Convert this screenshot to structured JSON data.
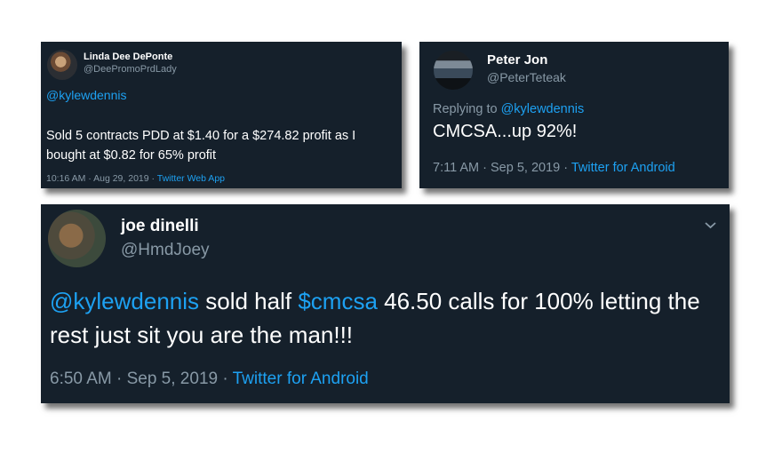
{
  "tweets": [
    {
      "name": "Linda Dee DePonte",
      "handle": "@DeePromoPrdLady",
      "mention": "@kylewdennis",
      "text": "Sold 5 contracts PDD at $1.40 for a $274.82 profit as I bought at $0.82 for 65% profit",
      "time": "10:16 AM · Aug 29, 2019 · ",
      "source": "Twitter Web App"
    },
    {
      "name": "Peter Jon",
      "handle": "@PeterTeteak",
      "replying_prefix": "Replying to ",
      "replying_to": "@kylewdennis",
      "text": "CMCSA...up 92%!",
      "time": "7:11 AM · Sep 5, 2019 · ",
      "source": "Twitter for Android"
    },
    {
      "name": "joe dinelli",
      "handle": "@HmdJoey",
      "mention": "@kylewdennis",
      "text_part1": " sold half ",
      "cashtag": "$cmcsa",
      "text_part2": " 46.50 calls for 100% letting the rest just sit you are the man!!!",
      "time": "6:50 AM · Sep 5, 2019 · ",
      "source": "Twitter for Android",
      "menu_icon": "chevron-down-icon"
    }
  ],
  "colors": {
    "background": "#15202b",
    "link": "#1da1f2",
    "secondary": "#8899a6",
    "text": "#ffffff"
  }
}
